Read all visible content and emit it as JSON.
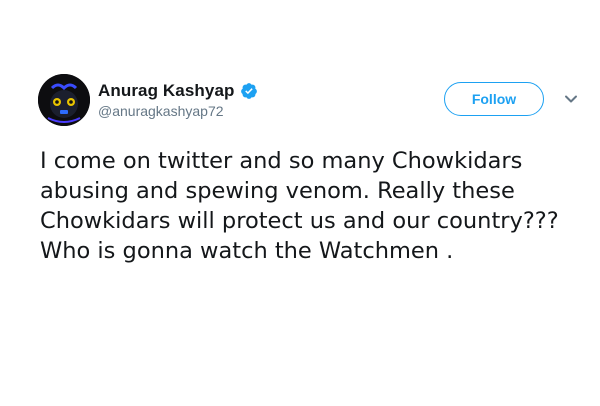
{
  "tweet": {
    "author": {
      "display_name": "Anurag Kashyap",
      "handle": "@anuragkashyap72",
      "verified": true,
      "avatar_icon": "profile-avatar"
    },
    "follow_label": "Follow",
    "menu_icon": "chevron-down-icon",
    "text_lines": [
      "I come on twitter and so many Chowkidars",
      "abusing and spewing venom. Really these",
      "Chowkidars will protect us and our country???",
      "Who is gonna watch the Watchmen ."
    ]
  },
  "colors": {
    "accent": "#1da1f2",
    "text_primary": "#14171a",
    "text_secondary": "#657786",
    "background": "#ffffff"
  }
}
